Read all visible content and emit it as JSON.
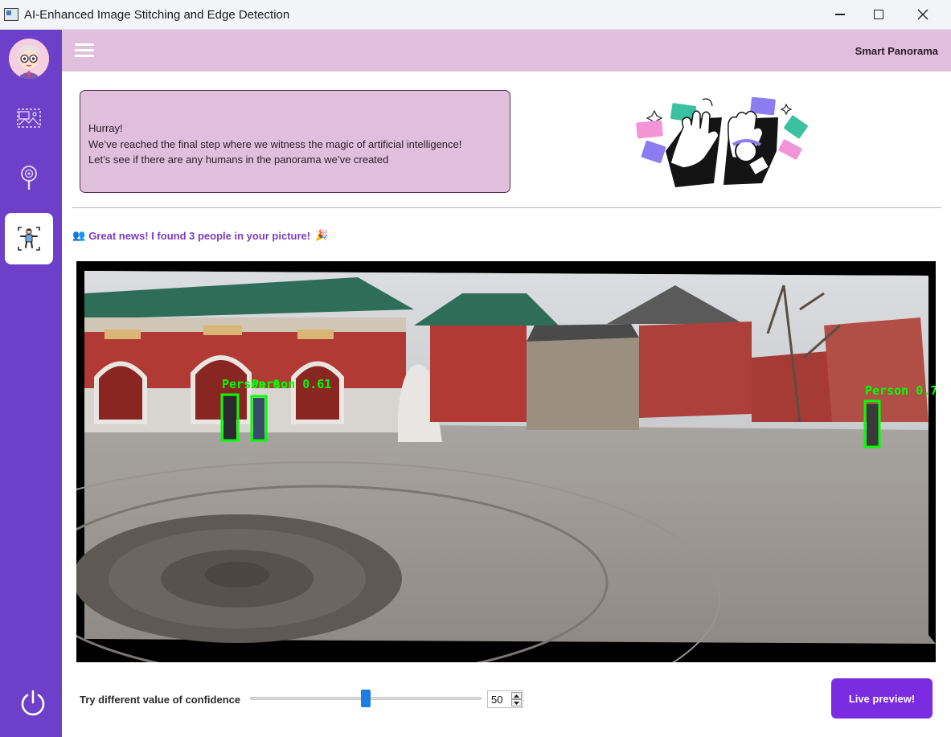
{
  "window": {
    "title": "AI-Enhanced  Image Stitching and Edge Detection"
  },
  "header": {
    "brand": "Smart Panorama"
  },
  "sidebar": {
    "items": [
      {
        "name": "gallery-icon"
      },
      {
        "name": "magnifier-icon"
      },
      {
        "name": "person-detect-icon",
        "active": true
      }
    ]
  },
  "message": {
    "line1": "Hurray!",
    "line2": "We’ve reached the final step where we witness the magic of artificial intelligence!",
    "line3": "Let’s see if there are any humans in the panorama we’ve created"
  },
  "result": {
    "text": "Great news! I found 3 people in your picture!",
    "leading_emoji": "👥",
    "trailing_emoji": "🎉"
  },
  "detections": [
    {
      "label": "Person 0.",
      "confidence_text": ""
    },
    {
      "label": "Person 0.61",
      "confidence_text": "0.61"
    },
    {
      "label": "Person 0.7",
      "confidence_text": ""
    }
  ],
  "controls": {
    "confidence_label": "Try different value of confidence",
    "confidence_value": "50",
    "confidence_fraction": 0.5,
    "live_preview_label": "Live preview!"
  },
  "colors": {
    "sidebar": "#6e3fc8",
    "header": "#e0bfdc",
    "accent_button": "#7b2be0",
    "detection_box": "#00ff00",
    "result_text": "#7e3ac0"
  }
}
